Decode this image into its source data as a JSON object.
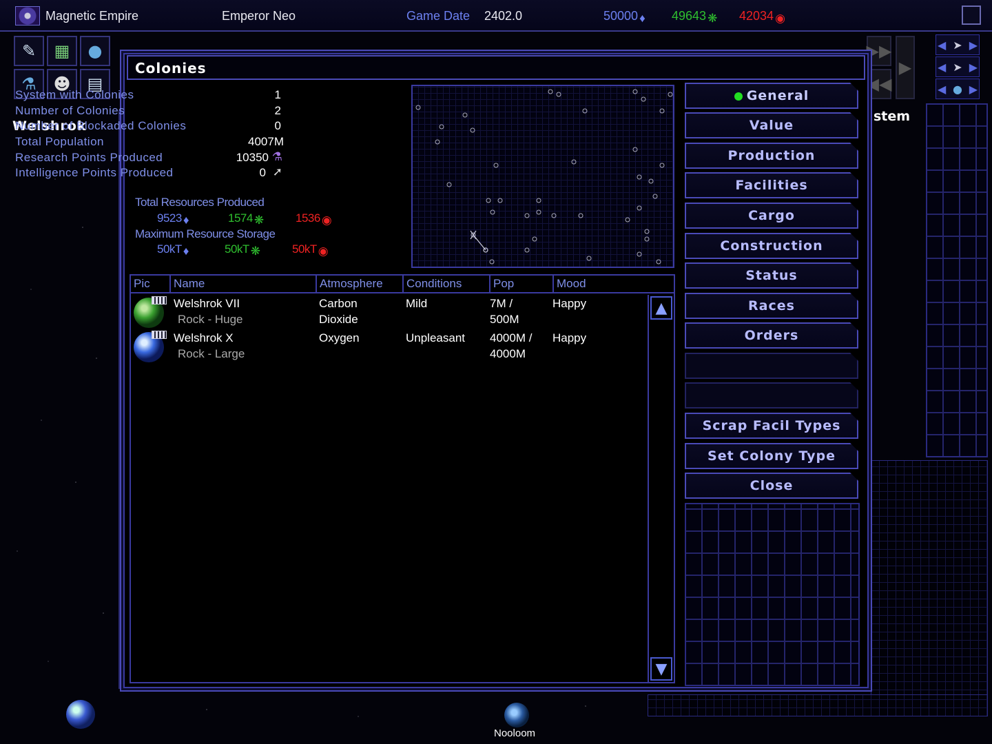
{
  "topbar": {
    "empire_name": "Magnetic Empire",
    "emperor": "Emperor Neo",
    "game_date_label": "Game Date",
    "game_date": "2402.0",
    "resources": [
      {
        "value": "50000",
        "color": "#6c80f0",
        "icon": "minerals-icon"
      },
      {
        "value": "49643",
        "color": "#2fbf2f",
        "icon": "organics-icon"
      },
      {
        "value": "42034",
        "color": "#ee2222",
        "icon": "radioactives-icon"
      }
    ]
  },
  "side": {
    "planet_title": "Welshrok",
    "system_title_partial": "stem"
  },
  "dialog": {
    "title": "Colonies",
    "stats": [
      {
        "label": "System  with  Colonies",
        "value": "1"
      },
      {
        "label": "Number  of  Colonies",
        "value": "2"
      },
      {
        "label": "Number  of  Blockaded  Colonies",
        "value": "0"
      },
      {
        "label": "Total  Population",
        "value": "4007M"
      },
      {
        "label": "Research  Points  Produced",
        "value": "10350"
      },
      {
        "label": "Intelligence  Points  Produced",
        "value": "0"
      }
    ],
    "resources_produced_label": "Total  Resources  Produced",
    "resources_produced": [
      "9523",
      "1574",
      "1536"
    ],
    "max_storage_label": "Maximum  Resource  Storage",
    "max_storage": [
      "50kT",
      "50kT",
      "50kT"
    ]
  },
  "table": {
    "headers": [
      "Pic",
      "Name",
      "Atmosphere",
      "Conditions",
      "Pop",
      "Mood"
    ],
    "rows": [
      {
        "name": "Welshrok VII",
        "type": "Rock - Huge",
        "atmosphere": "Carbon\nDioxide",
        "conditions": "Mild",
        "pop": "7M  /\n500M",
        "mood": "Happy",
        "planet_color": "green"
      },
      {
        "name": "Welshrok X",
        "type": "Rock - Large",
        "atmosphere": "Oxygen",
        "conditions": "Unpleasant",
        "pop": "4000M  /\n4000M",
        "mood": "Happy",
        "planet_color": "blue"
      }
    ]
  },
  "menu": {
    "buttons": [
      "General",
      "Value",
      "Production",
      "Facilities",
      "Cargo",
      "Construction",
      "Status",
      "Races",
      "Orders",
      "",
      "",
      "Scrap Facil Types",
      "Set Colony Type",
      "Close"
    ]
  },
  "map_labels": {
    "nooloom": "Nooloom"
  },
  "colors": {
    "accent": "#4a4ab8",
    "label_blue": "#7f8fe8",
    "active_dot": "#22dd22"
  }
}
